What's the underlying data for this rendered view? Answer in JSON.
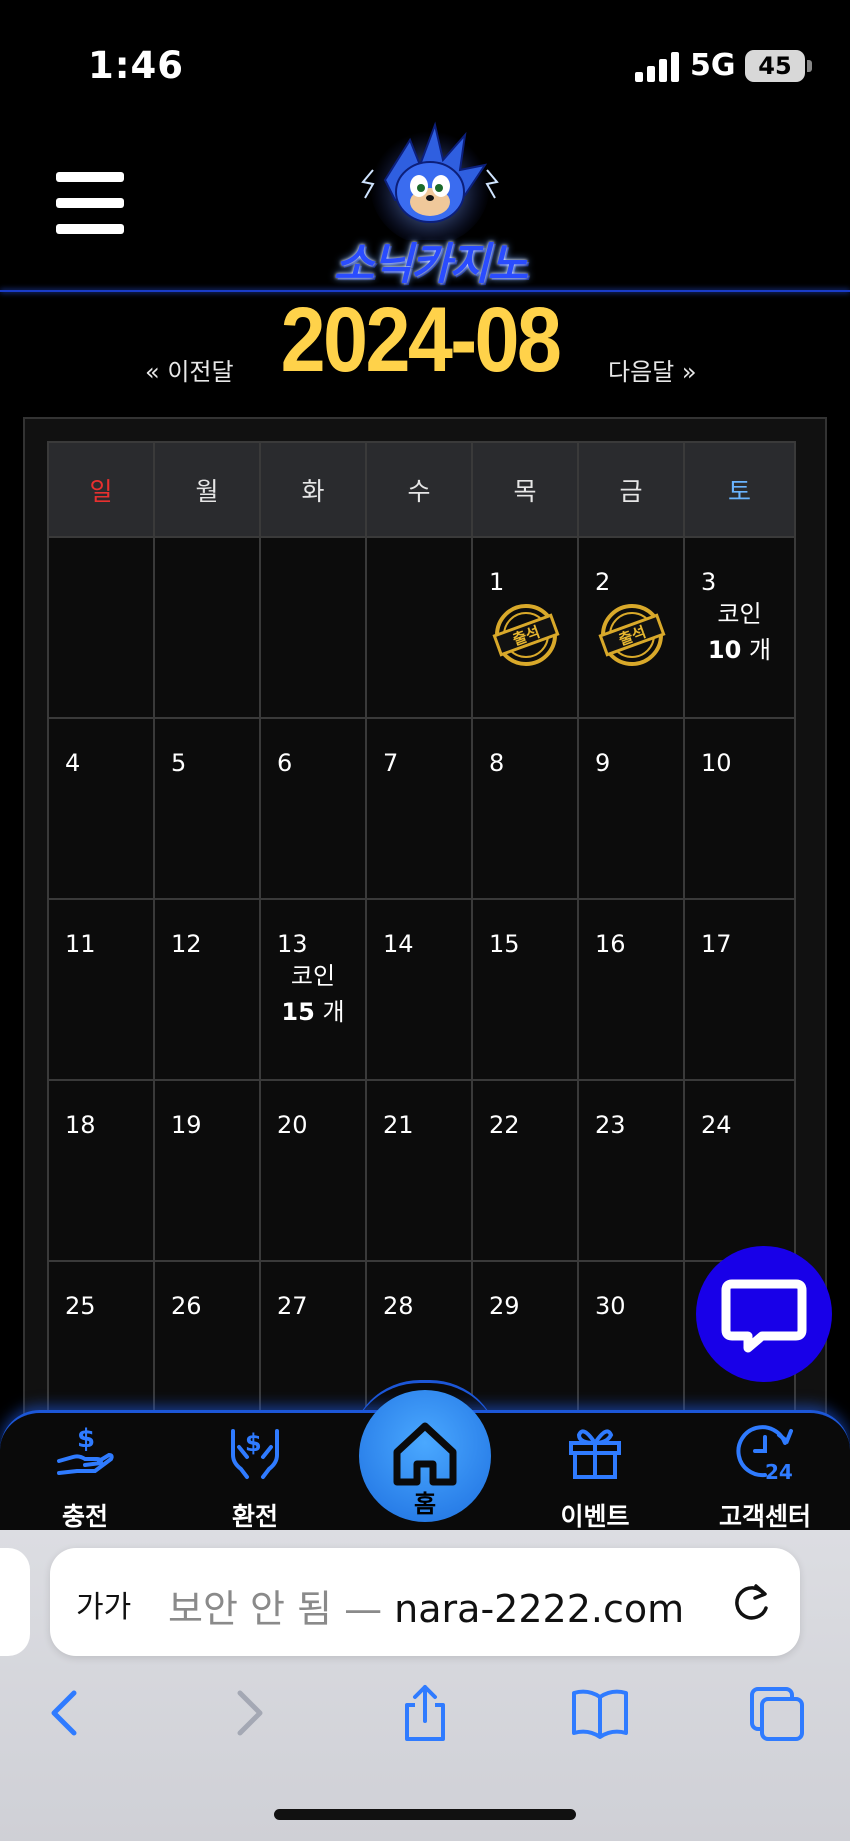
{
  "status": {
    "time": "1:46",
    "network": "5G",
    "battery": "45"
  },
  "header": {
    "logo_text": "소닉카지노"
  },
  "calendar": {
    "prev_label": "« 이전달",
    "next_label": "다음달 »",
    "title": "2024-08",
    "weekdays": [
      {
        "label": "일",
        "color": "#e8302f"
      },
      {
        "label": "월",
        "color": "#e6e6e6"
      },
      {
        "label": "화",
        "color": "#e6e6e6"
      },
      {
        "label": "수",
        "color": "#e6e6e6"
      },
      {
        "label": "목",
        "color": "#e6e6e6"
      },
      {
        "label": "금",
        "color": "#e6e6e6"
      },
      {
        "label": "토",
        "color": "#6ab4ff"
      }
    ],
    "coin_word": "코인",
    "coin_unit": "개",
    "stamp_text": "출석",
    "weeks": [
      [
        "",
        "",
        "",
        "",
        "1",
        "2",
        "3"
      ],
      [
        "4",
        "5",
        "6",
        "7",
        "8",
        "9",
        "10"
      ],
      [
        "11",
        "12",
        "13",
        "14",
        "15",
        "16",
        "17"
      ],
      [
        "18",
        "19",
        "20",
        "21",
        "22",
        "23",
        "24"
      ],
      [
        "25",
        "26",
        "27",
        "28",
        "29",
        "30",
        ""
      ]
    ],
    "attended_days": [
      "1",
      "2"
    ],
    "coin_rewards": {
      "3": "10",
      "13": "15"
    }
  },
  "bottom_nav": {
    "items": [
      {
        "label": "충전",
        "icon": "deposit-hand-dollar-icon"
      },
      {
        "label": "환전",
        "icon": "exchange-hands-dollar-icon"
      },
      {
        "label": "이벤트",
        "icon": "gift-icon"
      },
      {
        "label": "고객센터",
        "icon": "support-24h-icon"
      }
    ],
    "home_label": "홈"
  },
  "browser": {
    "text_size_label": "가가",
    "security_label": "보안 안 됨 —",
    "domain": "nara-2222.com"
  },
  "colors": {
    "accent_blue": "#1c57d8",
    "title_gold": "#ffd24a",
    "chat_blue": "#1800e8",
    "icon_blue": "#2f7bff"
  }
}
